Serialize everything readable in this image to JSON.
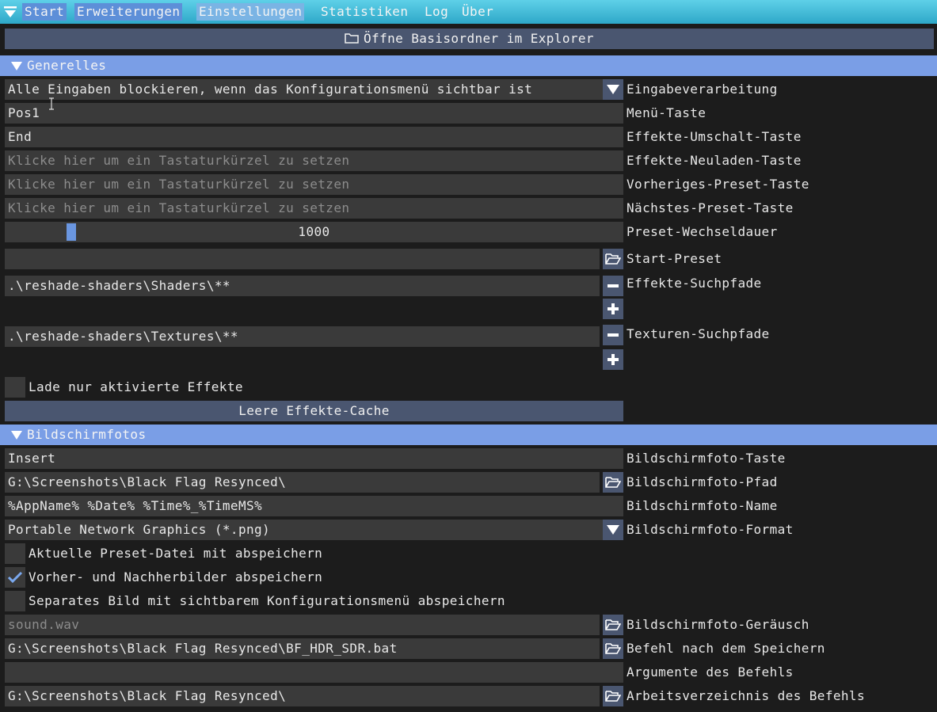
{
  "menu": {
    "items": [
      {
        "label": "Start"
      },
      {
        "label": "Erweiterungen"
      },
      {
        "label": "Einstellungen"
      },
      {
        "label": "Statistiken"
      },
      {
        "label": "Log"
      },
      {
        "label": "Über"
      }
    ]
  },
  "open_folder_button": "Öffne Basisordner im Explorer",
  "general": {
    "header": "Generelles",
    "input_processing": {
      "value": "Alle Eingaben blockieren, wenn das Konfigurationsmenü sichtbar ist",
      "label": "Eingabeverarbeitung"
    },
    "menu_key": {
      "value": "Pos1",
      "label": "Menü-Taste"
    },
    "effects_toggle_key": {
      "value": "End",
      "label": "Effekte-Umschalt-Taste"
    },
    "effects_reload_key": {
      "placeholder": "Klicke hier um ein Tastaturkürzel zu setzen",
      "label": "Effekte-Neuladen-Taste"
    },
    "prev_preset_key": {
      "placeholder": "Klicke hier um ein Tastaturkürzel zu setzen",
      "label": "Vorheriges-Preset-Taste"
    },
    "next_preset_key": {
      "placeholder": "Klicke hier um ein Tastaturkürzel zu setzen",
      "label": "Nächstes-Preset-Taste"
    },
    "preset_transition": {
      "value": "1000",
      "label": "Preset-Wechseldauer"
    },
    "start_preset": {
      "value": "",
      "label": "Start-Preset"
    },
    "effect_search_paths": {
      "values": [
        ".\\reshade-shaders\\Shaders\\**"
      ],
      "label": "Effekte-Suchpfade"
    },
    "texture_search_paths": {
      "values": [
        ".\\reshade-shaders\\Textures\\**"
      ],
      "label": "Texturen-Suchpfade"
    },
    "load_only_enabled": {
      "label": "Lade nur aktivierte Effekte",
      "checked": false
    },
    "clear_cache_button": "Leere Effekte-Cache"
  },
  "screenshots": {
    "header": "Bildschirmfotos",
    "key": {
      "value": "Insert",
      "label": "Bildschirmfoto-Taste"
    },
    "path": {
      "value": "G:\\Screenshots\\Black Flag Resynced\\",
      "label": "Bildschirmfoto-Pfad"
    },
    "name": {
      "value": "%AppName% %Date% %Time%_%TimeMS%",
      "label": "Bildschirmfoto-Name"
    },
    "format": {
      "value": "Portable Network Graphics (*.png)",
      "label": "Bildschirmfoto-Format"
    },
    "save_preset": {
      "label": "Aktuelle Preset-Datei mit abspeichern",
      "checked": false
    },
    "save_before_after": {
      "label": "Vorher- und Nachherbilder abspeichern",
      "checked": true
    },
    "save_overlay": {
      "label": "Separates Bild mit sichtbarem Konfigurationsmenü abspeichern",
      "checked": false
    },
    "sound": {
      "placeholder": "sound.wav",
      "label": "Bildschirmfoto-Geräusch"
    },
    "post_save_cmd": {
      "value": "G:\\Screenshots\\Black Flag Resynced\\BF_HDR_SDR.bat",
      "label": "Befehl nach dem Speichern"
    },
    "cmd_args": {
      "value": "",
      "label": "Argumente des Befehls"
    },
    "cmd_workdir": {
      "value": "G:\\Screenshots\\Black Flag Resynced\\",
      "label": "Arbeitsverzeichnis des Befehls"
    }
  },
  "colors": {
    "accent": "#7a9ee6",
    "menubar": "#2ea8c8",
    "field": "#3a3a3a",
    "button": "#4a5670",
    "background": "#1c1c1c"
  }
}
